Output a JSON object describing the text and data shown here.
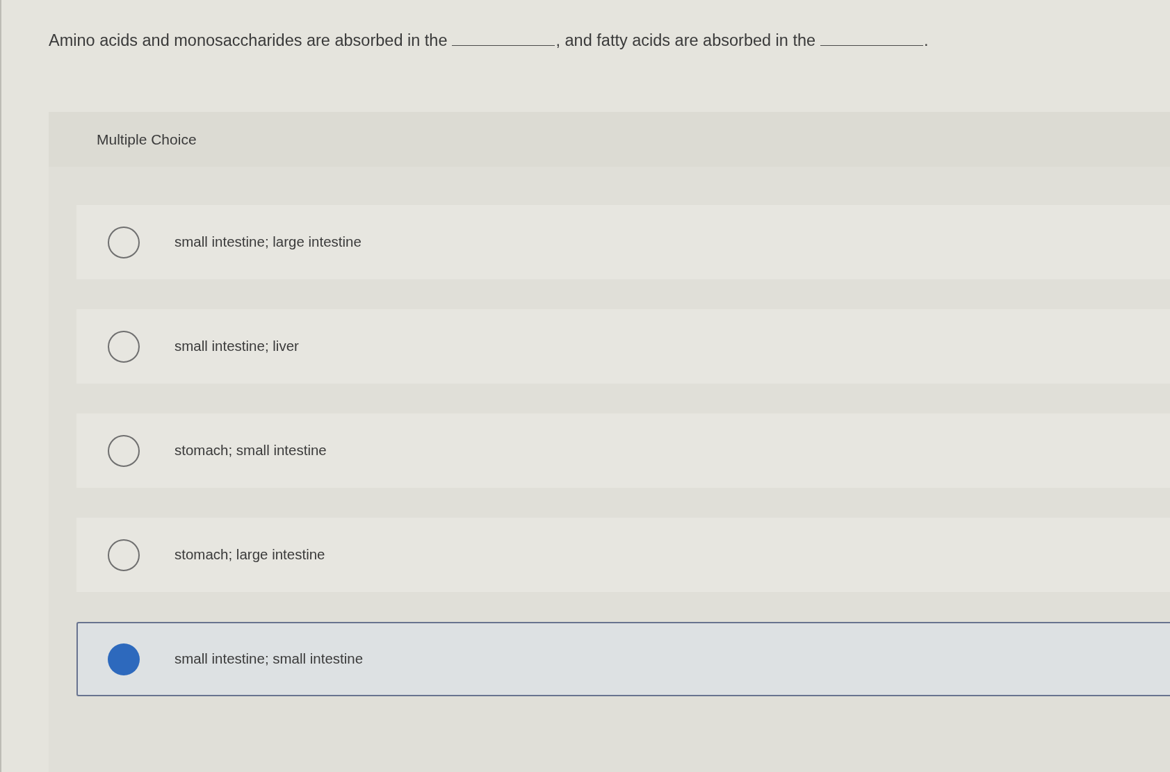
{
  "question": {
    "segments": [
      {
        "kind": "text",
        "text": "Amino acids and monosaccharides are absorbed in the"
      },
      {
        "kind": "blank"
      },
      {
        "kind": "text",
        "text": ", and fatty acids are absorbed in the"
      },
      {
        "kind": "blank"
      },
      {
        "kind": "text",
        "text": "."
      }
    ]
  },
  "panel": {
    "heading": "Multiple Choice"
  },
  "options": [
    {
      "label": "small intestine; large intestine",
      "selected": false
    },
    {
      "label": "small intestine; liver",
      "selected": false
    },
    {
      "label": "stomach; small intestine",
      "selected": false
    },
    {
      "label": "stomach; large intestine",
      "selected": false
    },
    {
      "label": "small intestine; small intestine",
      "selected": true
    }
  ]
}
